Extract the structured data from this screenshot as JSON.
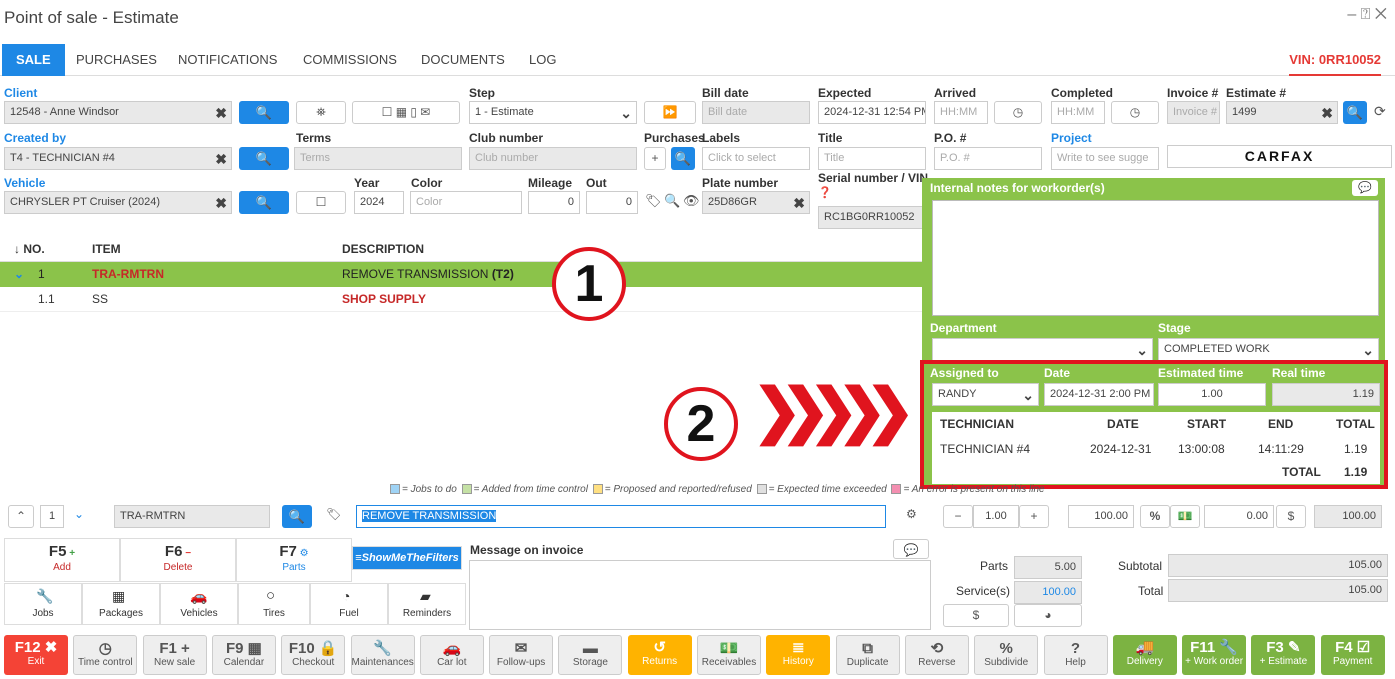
{
  "window": {
    "title": "Point of sale - Estimate",
    "controls": "– ⍰ ✕"
  },
  "tabs": [
    "SALE",
    "PURCHASES",
    "NOTIFICATIONS",
    "COMMISSIONS",
    "DOCUMENTS",
    "LOG"
  ],
  "vin_label": "VIN: 0RR10052",
  "form": {
    "client_label": "Client",
    "client_value": "12548 - Anne Windsor",
    "step_label": "Step",
    "step_value": "1 - Estimate",
    "bill_date_label": "Bill date",
    "bill_date_ph": "Bill date",
    "expected_label": "Expected",
    "expected_value": "2024-12-31 12:54 PM",
    "arrived_label": "Arrived",
    "arrived_ph": "HH:MM",
    "completed_label": "Completed",
    "completed_ph": "HH:MM",
    "invoice_label": "Invoice #",
    "invoice_ph": "Invoice #",
    "estimate_label": "Estimate #",
    "estimate_value": "1499",
    "created_label": "Created by",
    "created_value": "T4 - TECHNICIAN #4",
    "terms_label": "Terms",
    "terms_ph": "Terms",
    "club_label": "Club number",
    "club_ph": "Club number",
    "purchases_label": "Purchases",
    "labels_label": "Labels",
    "labels_ph": "Click to select",
    "title_label": "Title",
    "title_ph": "Title",
    "po_label": "P.O. #",
    "po_ph": "P.O. #",
    "project_label": "Project",
    "project_ph": "Write to see sugge",
    "carfax": "CARFAX",
    "vehicle_label": "Vehicle",
    "vehicle_value": "CHRYSLER PT Cruiser (2024)",
    "year_label": "Year",
    "year_value": "2024",
    "color_label": "Color",
    "color_ph": "Color",
    "mileage_label": "Mileage",
    "mileage_value": "0",
    "out_label": "Out",
    "out_value": "0",
    "plate_label": "Plate number",
    "plate_value": "25D86GR",
    "serial_label": "Serial number / VIN",
    "serial_value": "RC1BG0RR10052"
  },
  "table": {
    "headers": [
      "↓ NO.",
      "ITEM",
      "DESCRIPTION"
    ],
    "rows": [
      {
        "no": "1",
        "item": "TRA-RMTRN",
        "desc": "REMOVE TRANSMISSION",
        "desc_bold": "(T2)"
      },
      {
        "no": "1.1",
        "item": "SS",
        "desc": "SHOP SUPPLY"
      }
    ]
  },
  "panel": {
    "notes_label": "Internal notes for workorder(s)",
    "department_label": "Department",
    "stage_label": "Stage",
    "stage_value": "COMPLETED WORK",
    "assigned_label": "Assigned to",
    "assigned_value": "RANDY",
    "date_label": "Date",
    "date_value": "2024-12-31 2:00 PM",
    "est_label": "Estimated time",
    "est_value": "1.00",
    "real_label": "Real time",
    "real_value": "1.19",
    "tech_headers": [
      "TECHNICIAN",
      "DATE",
      "START",
      "END",
      "TOTAL"
    ],
    "tech_row": [
      "TECHNICIAN #4",
      "2024-12-31",
      "13:00:08",
      "14:11:29",
      "1.19"
    ],
    "total_label": "TOTAL",
    "total_value": "1.19"
  },
  "callouts": {
    "one": "1",
    "two": "2"
  },
  "legend": [
    {
      "color": "#9fd3f5",
      "text": "= Jobs to do"
    },
    {
      "color": "#c5e1a5",
      "text": "= Added from time control"
    },
    {
      "color": "#ffe082",
      "text": "= Proposed and reported/refused"
    },
    {
      "color": "#e0e0e0",
      "text": "= Expected time exceeded"
    },
    {
      "color": "#f48fb1",
      "text": "= An error is present on this line"
    }
  ],
  "edit": {
    "line": "1",
    "code": "TRA-RMTRN",
    "desc": "REMOVE TRANSMISSION",
    "qty": "1.00",
    "price": "100.00",
    "discount": "0.00",
    "total": "100.00"
  },
  "fkeys": [
    {
      "key": "F5",
      "label": "Add",
      "icon": "+"
    },
    {
      "key": "F6",
      "label": "Delete",
      "icon": "−"
    },
    {
      "key": "F7",
      "label": "Parts",
      "icon": "⚙"
    },
    {
      "key": "",
      "label": "≡ShowMeTheFilters",
      "icon": ""
    }
  ],
  "quick": [
    "Jobs",
    "Packages",
    "Vehicles",
    "Tires",
    "Fuel",
    "Reminders"
  ],
  "message_label": "Message on invoice",
  "totals": {
    "parts_label": "Parts",
    "parts_value": "5.00",
    "services_label": "Service(s)",
    "services_value": "100.00",
    "subtotal_label": "Subtotal",
    "subtotal_value": "105.00",
    "total_label": "Total",
    "total_value": "105.00"
  },
  "bottom": [
    {
      "key": "F12",
      "label": "Exit",
      "style": "red",
      "icon": "✖"
    },
    {
      "key": "",
      "label": "Time control",
      "style": "gray",
      "icon": "◷"
    },
    {
      "key": "F1",
      "label": "New sale",
      "style": "gray",
      "icon": "+"
    },
    {
      "key": "F9",
      "label": "Calendar",
      "style": "gray",
      "icon": "▦"
    },
    {
      "key": "F10",
      "label": "Checkout",
      "style": "gray",
      "icon": "🔒"
    },
    {
      "key": "",
      "label": "Maintenances",
      "style": "gray",
      "icon": "🔧"
    },
    {
      "key": "",
      "label": "Car lot",
      "style": "gray",
      "icon": "🚗"
    },
    {
      "key": "",
      "label": "Follow-ups",
      "style": "gray",
      "icon": "✉"
    },
    {
      "key": "",
      "label": "Storage",
      "style": "gray",
      "icon": "▬"
    },
    {
      "key": "",
      "label": "Returns",
      "style": "orange",
      "icon": "↺"
    },
    {
      "key": "",
      "label": "Receivables",
      "style": "gray",
      "icon": "💵"
    },
    {
      "key": "",
      "label": "History",
      "style": "orange",
      "icon": "≣"
    },
    {
      "key": "",
      "label": "Duplicate",
      "style": "gray",
      "icon": "⧉"
    },
    {
      "key": "",
      "label": "Reverse",
      "style": "gray",
      "icon": "⟲"
    },
    {
      "key": "",
      "label": "Subdivide",
      "style": "gray",
      "icon": "%"
    },
    {
      "key": "",
      "label": "Help",
      "style": "gray",
      "icon": "?"
    },
    {
      "key": "",
      "label": "Delivery",
      "style": "green",
      "icon": "🚚"
    },
    {
      "key": "F11",
      "label": "+ Work order",
      "style": "green",
      "icon": "🔧"
    },
    {
      "key": "F3",
      "label": "+ Estimate",
      "style": "green",
      "icon": "✎"
    },
    {
      "key": "F4",
      "label": "Payment",
      "style": "green",
      "icon": "☑"
    }
  ]
}
